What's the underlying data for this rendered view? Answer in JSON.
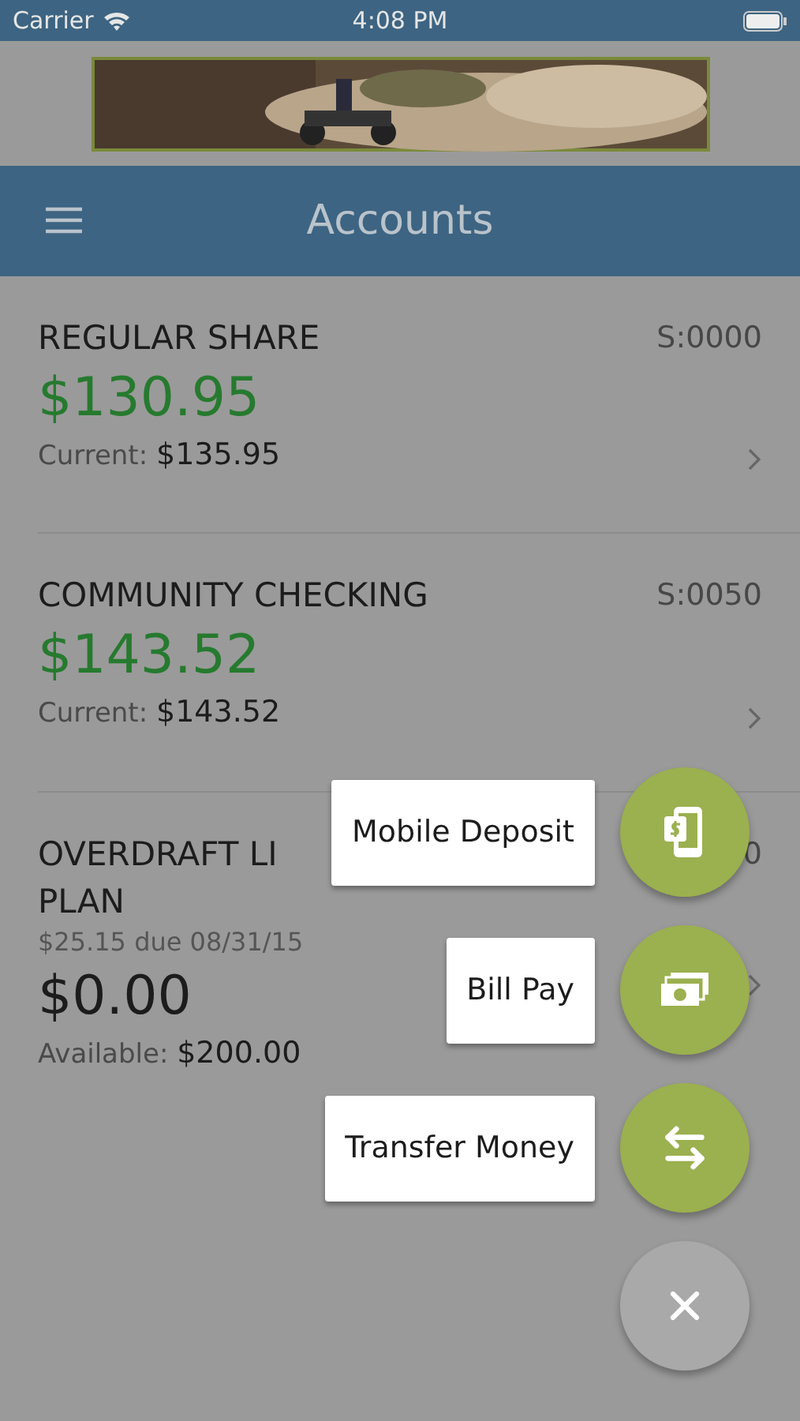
{
  "status_bar": {
    "carrier": "Carrier",
    "time": "4:08 PM"
  },
  "header": {
    "title": "Accounts"
  },
  "accounts": [
    {
      "kind": "deposit",
      "name_lines": [
        "REGULAR SHARE"
      ],
      "number": "S:0000",
      "balance": "$130.95",
      "detail_label": "Current:",
      "detail_value": "$135.95"
    },
    {
      "kind": "deposit",
      "name_lines": [
        "COMMUNITY CHECKING"
      ],
      "number": "S:0050",
      "balance": "$143.52",
      "detail_label": "Current:",
      "detail_value": "$143.52"
    },
    {
      "kind": "loan",
      "name_lines": [
        "OVERDRAFT LI",
        "PLAN"
      ],
      "number": "0",
      "due": "$25.15 due 08/31/15",
      "balance": "$0.00",
      "detail_label": "Available:",
      "detail_value": "$200.00"
    }
  ],
  "actions": [
    {
      "kind": "deposit",
      "label": "Mobile Deposit"
    },
    {
      "kind": "bill",
      "label": "Bill Pay"
    },
    {
      "kind": "transfer",
      "label": "Transfer Money"
    }
  ]
}
